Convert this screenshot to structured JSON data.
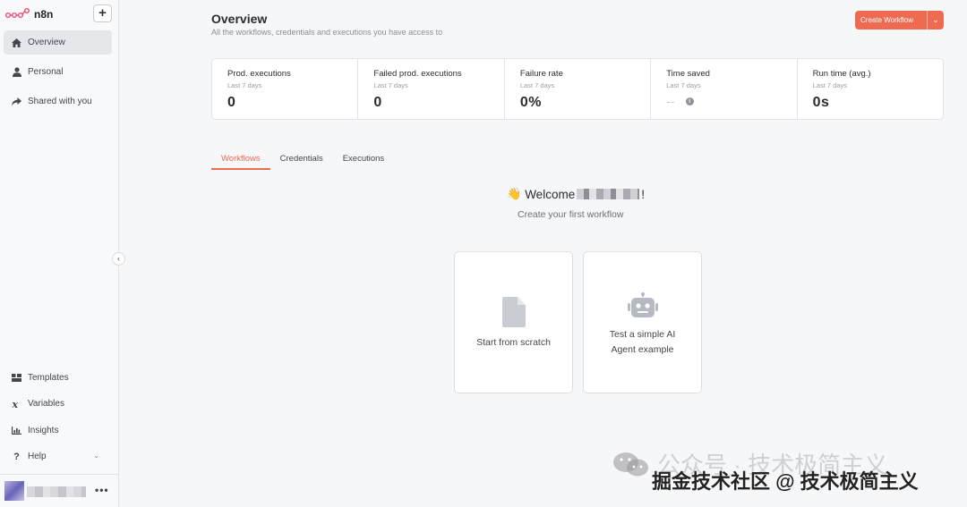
{
  "app": {
    "name": "n8n"
  },
  "sidebar": {
    "add_label": "+",
    "nav": [
      {
        "label": "Overview",
        "icon": "home-icon",
        "active": true
      },
      {
        "label": "Personal",
        "icon": "user-icon"
      },
      {
        "label": "Shared with you",
        "icon": "share-icon"
      }
    ],
    "bottom_nav": [
      {
        "label": "Templates",
        "icon": "templates-icon"
      },
      {
        "label": "Variables",
        "icon": "variable-icon"
      },
      {
        "label": "Insights",
        "icon": "chart-icon"
      },
      {
        "label": "Help",
        "icon": "help-icon"
      }
    ],
    "more_label": "•••"
  },
  "header": {
    "title": "Overview",
    "subtitle": "All the workflows, credentials and executions you have access to",
    "create_label": "Create Workflow",
    "dropdown_glyph": "⌄"
  },
  "stats": [
    {
      "title": "Prod. executions",
      "period": "Last 7 days",
      "value": "0"
    },
    {
      "title": "Failed prod. executions",
      "period": "Last 7 days",
      "value": "0"
    },
    {
      "title": "Failure rate",
      "period": "Last 7 days",
      "value": "0%"
    },
    {
      "title": "Time saved",
      "period": "Last 7 days",
      "value": "--"
    },
    {
      "title": "Run time (avg.)",
      "period": "Last 7 days",
      "value": "0s"
    }
  ],
  "tabs": [
    {
      "label": "Workflows",
      "active": true
    },
    {
      "label": "Credentials"
    },
    {
      "label": "Executions"
    }
  ],
  "welcome": {
    "emoji": "👋",
    "prefix": "Welcome",
    "suffix": "!",
    "subtitle": "Create your first workflow"
  },
  "cards": [
    {
      "label": "Start from scratch",
      "icon": "file-icon"
    },
    {
      "label_line1": "Test a simple AI",
      "label_line2": "Agent example",
      "icon": "robot-icon"
    }
  ],
  "watermark": {
    "line1": "公众号 · 技术极简主义",
    "line2": "掘金技术社区 @ 技术极简主义"
  },
  "colors": {
    "accent": "#ee6b52",
    "sidebar_bg": "#f8f9fa",
    "page_bg": "#f6f7f8"
  }
}
